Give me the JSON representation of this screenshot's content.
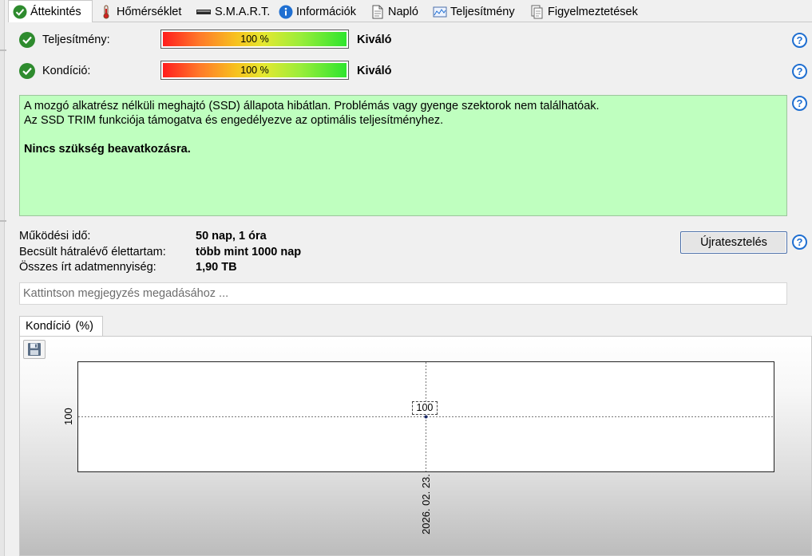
{
  "tabs": [
    {
      "label": "Áttekintés",
      "icon": "check-circle-icon",
      "active": true
    },
    {
      "label": "Hőmérséklet",
      "icon": "thermometer-icon"
    },
    {
      "label": "S.M.A.R.T.",
      "icon": "drive-icon"
    },
    {
      "label": "Információk",
      "icon": "info-icon"
    },
    {
      "label": "Napló",
      "icon": "document-icon"
    },
    {
      "label": "Teljesítmény",
      "icon": "performance-chart-icon"
    },
    {
      "label": "Figyelmeztetések",
      "icon": "alerts-icon"
    }
  ],
  "status": {
    "performance": {
      "label": "Teljesítmény:",
      "value_text": "100 %",
      "percent": 100,
      "grade": "Kiváló"
    },
    "condition": {
      "label": "Kondíció:",
      "value_text": "100 %",
      "percent": 100,
      "grade": "Kiváló"
    }
  },
  "message": {
    "line1": "A mozgó alkatrész nélküli meghajtó (SSD) állapota hibátlan. Problémás vagy gyenge szektorok nem találhatóak.",
    "line2": "Az SSD TRIM funkciója támogatva és engedélyezve az optimális teljesítményhez.",
    "line3": "Nincs szükség beavatkozásra."
  },
  "info": {
    "uptime_label": "Működési idő:",
    "uptime_value": "50 nap, 1 óra",
    "lifetime_label": "Becsült hátralévő élettartam:",
    "lifetime_value": "több mint 1000 nap",
    "written_label": "Összes írt adatmennyiség:",
    "written_value": "1,90 TB"
  },
  "retest_button": "Újratesztelés",
  "note_placeholder": "Kattintson megjegyzés megadásához ...",
  "chart_tab": {
    "label": "Kondíció",
    "unit": "(%)"
  },
  "colors": {
    "ok_green": "#2e8b2e",
    "message_bg": "#bfffbf",
    "help_blue": "#1f6fd1"
  },
  "chart_data": {
    "type": "line",
    "title": "",
    "xlabel": "",
    "ylabel": "",
    "x": [
      "2026. 02. 23."
    ],
    "y_ticks": [
      "100"
    ],
    "series": [
      {
        "values": [
          100
        ]
      }
    ],
    "data_labels": [
      "100"
    ],
    "grid": true
  }
}
